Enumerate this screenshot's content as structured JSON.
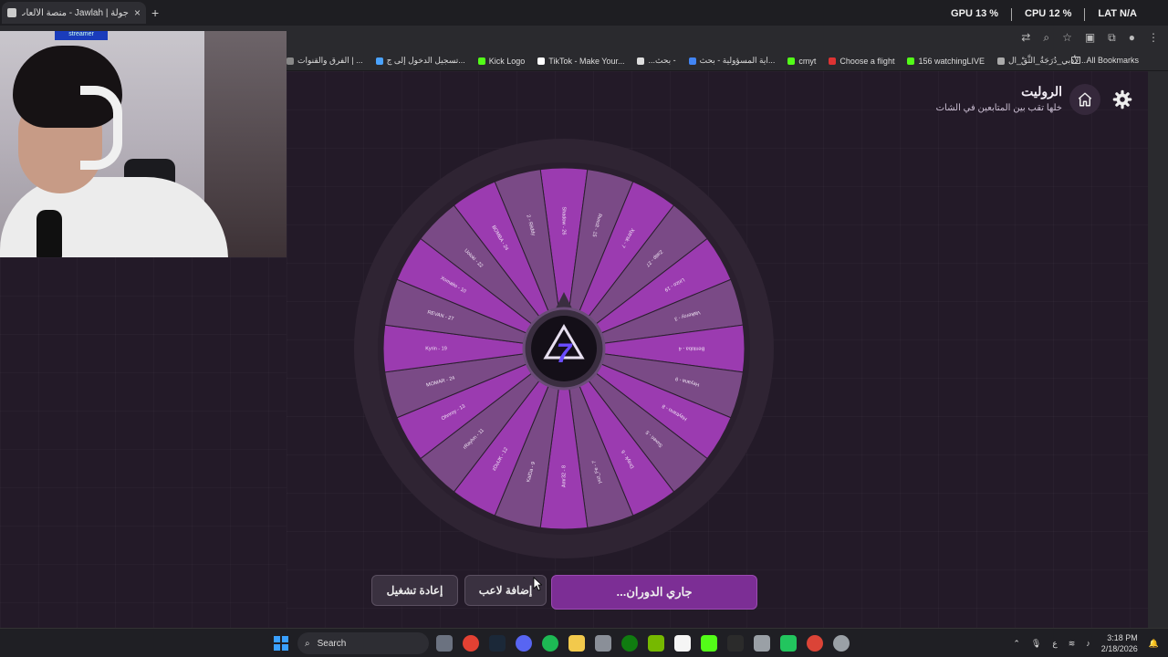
{
  "browser": {
    "tab_title": "جولة | Jawlah - منصة الألعاب ال...",
    "tab_close": "×",
    "new_tab": "+",
    "perf": {
      "gpu_label": "GPU",
      "gpu_value": "13 %",
      "cpu_label": "CPU",
      "cpu_value": "12 %",
      "lat_label": "LAT",
      "lat_value": "N/A"
    },
    "bookmarks": [
      {
        "label": "الفرق والقنوات | ...",
        "color": "#888888"
      },
      {
        "label": "تسجيل الدخول إلى ج...",
        "color": "#4aa3ff"
      },
      {
        "label": "Kick Logo",
        "color": "#53fc18"
      },
      {
        "label": "TikTok - Make Your...",
        "color": "#ffffff"
      },
      {
        "label": "...بحث - ",
        "color": "#dddddd"
      },
      {
        "label": "اية المسؤولية - بحث...",
        "color": "#4285f4"
      },
      {
        "label": "cmyt",
        "color": "#53fc18"
      },
      {
        "label": "Choose a flight",
        "color": "#d33"
      },
      {
        "label": "156 watchingLIVE",
        "color": "#53fc18"
      },
      {
        "label": "الأدبي_دُرَجَةُ_الثَّقْ_ال...",
        "color": "#aaaaaa"
      }
    ],
    "all_bookmarks": "All Bookmarks"
  },
  "webcam": {
    "nametag": "streamer"
  },
  "header": {
    "title": "الروليت",
    "subtitle": "خلها تقب بين المتابعين في الشات"
  },
  "wheel": {
    "segments": [
      "Shadow - 26",
      "Rvnclt - 15",
      "Xptrsk - 7",
      "Zatip - 27",
      "Lirizo - 19",
      "Valkeroy - 3",
      "Bentoba - 4",
      "Heyana - 9",
      "Haytrano - 8",
      "Suxeri - 5",
      "Drayk - 6",
      "yuz_Fe - 7",
      "Amr32 - 8",
      "KaiDa - 9",
      "zDuUK - 12",
      "rRaylvn - 11",
      "Ohnroy - 13",
      "MOMAR - 24",
      "Kyrin - 19",
      "REVAN - 27",
      "Xomaito - 10",
      "Uoloki - 22",
      "BOMBA - 24",
      "2 - Riiddy"
    ],
    "colors": [
      "#9b3bb0",
      "#7a4a86"
    ],
    "center_logo": "7"
  },
  "buttons": {
    "restart": "إعادة تشغيل",
    "add_player": "إضافة لاعب",
    "spinning": "جاري الدوران..."
  },
  "taskbar": {
    "search_placeholder": "Search",
    "lang": "ع",
    "time": "3:18 PM",
    "date": "2/18/2026"
  }
}
